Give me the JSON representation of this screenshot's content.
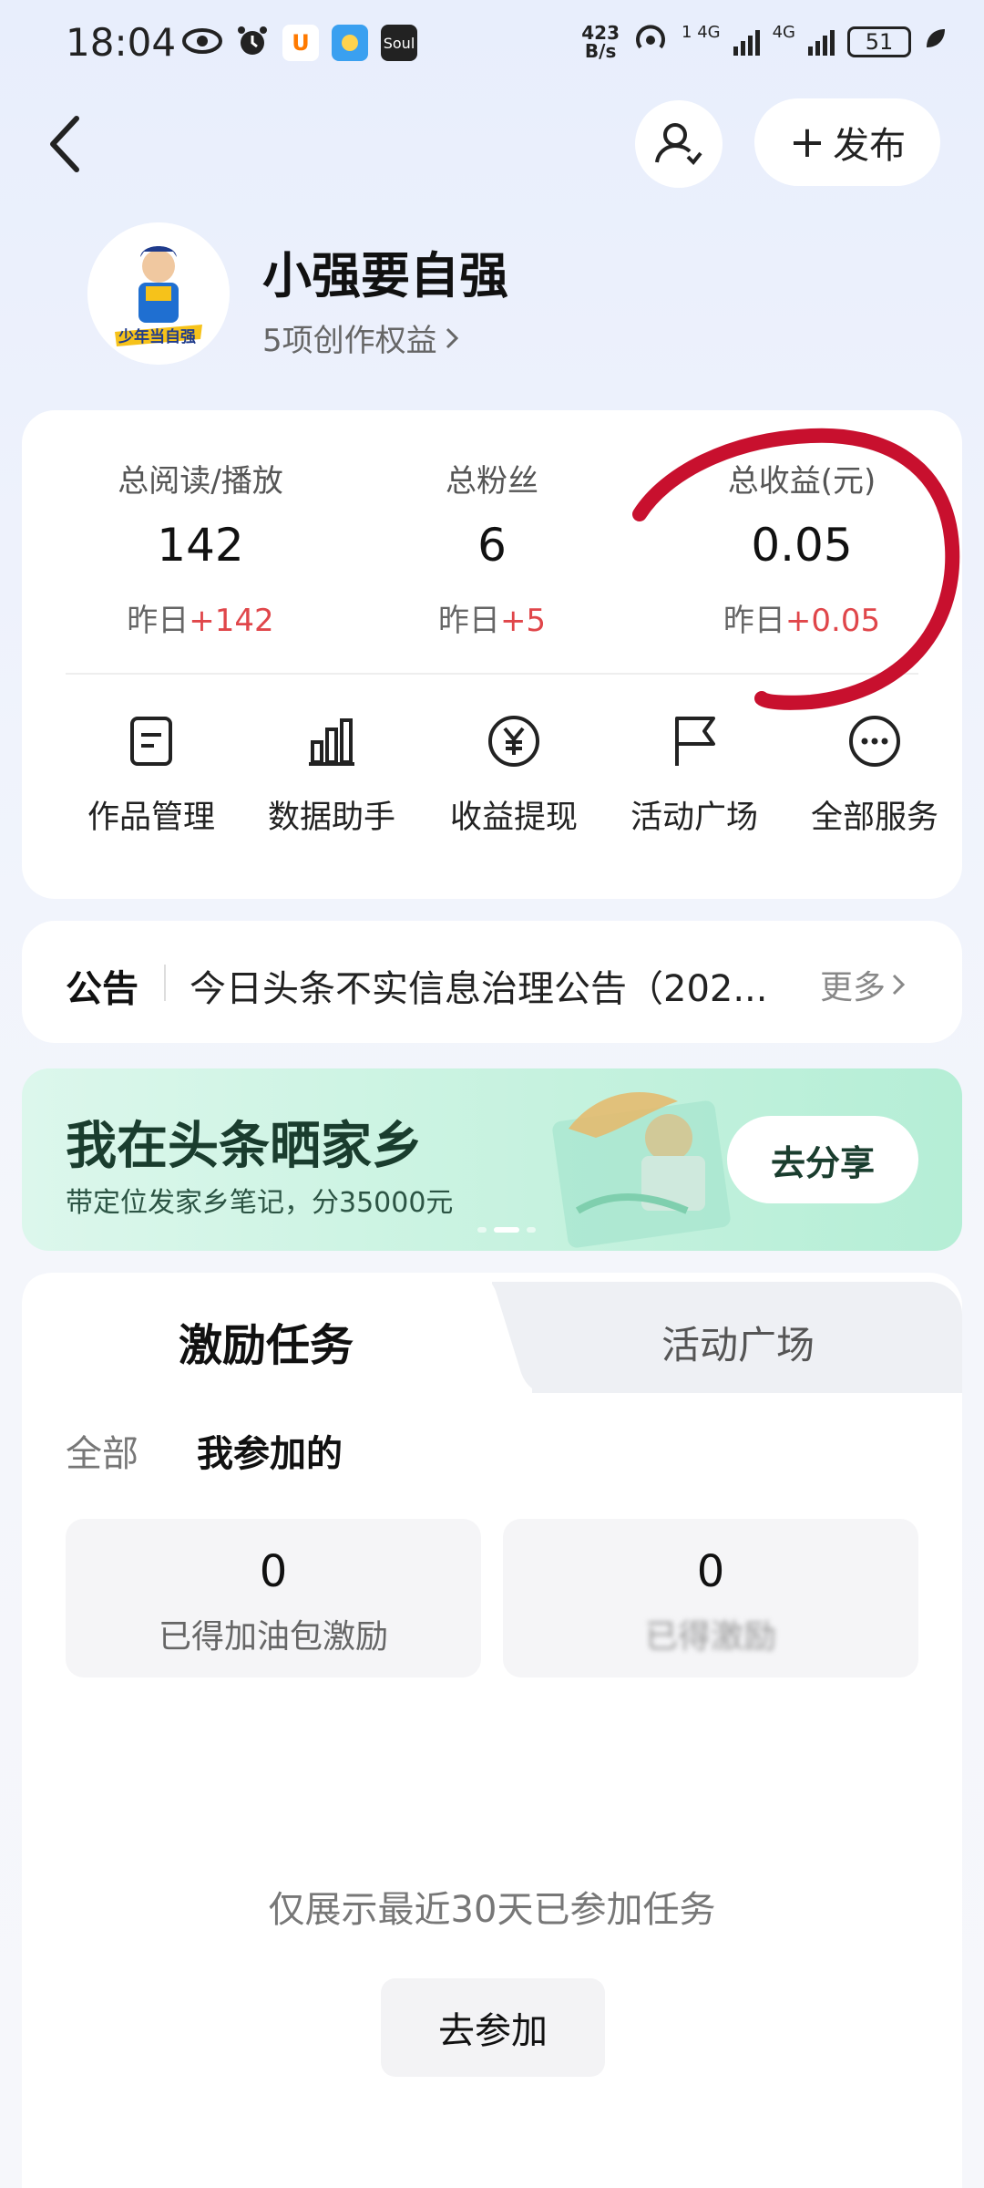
{
  "status_bar": {
    "time": "18:04",
    "net_speed_value": "423",
    "net_speed_unit": "B/s",
    "sim1_label": "4G",
    "sim2_label": "4G",
    "hd_label": "1",
    "battery": "51",
    "soul_label": "Soul"
  },
  "header": {
    "publish_label": "发布"
  },
  "profile": {
    "name": "小强要自强",
    "rights_link": "5项创作权益",
    "avatar_text": "少年当自强"
  },
  "stats": [
    {
      "label": "总阅读/播放",
      "value": "142",
      "delta_prefix": "昨日",
      "delta": "+142"
    },
    {
      "label": "总粉丝",
      "value": "6",
      "delta_prefix": "昨日",
      "delta": "+5"
    },
    {
      "label": "总收益(元)",
      "value": "0.05",
      "delta_prefix": "昨日",
      "delta": "+0.05"
    }
  ],
  "tools": [
    {
      "label": "作品管理",
      "icon": "document-icon"
    },
    {
      "label": "数据助手",
      "icon": "bar-chart-icon"
    },
    {
      "label": "收益提现",
      "icon": "yen-circle-icon"
    },
    {
      "label": "活动广场",
      "icon": "flag-icon"
    },
    {
      "label": "全部服务",
      "icon": "more-dots-icon"
    }
  ],
  "notice": {
    "tag": "公告",
    "text": "今日头条不实信息治理公告（202...",
    "more": "更多"
  },
  "banner": {
    "title": "我在头条晒家乡",
    "subtitle": "带定位发家乡笔记，分35000元",
    "button": "去分享"
  },
  "tasks": {
    "tab_active": "激励任务",
    "tab_inactive": "活动广场",
    "filter_all": "全部",
    "filter_mine": "我参加的",
    "metrics": [
      {
        "value": "0",
        "label": "已得加油包激励"
      },
      {
        "value": "0",
        "label": "已得激励"
      }
    ],
    "empty_hint": "仅展示最近30天已参加任务",
    "join_button": "去参加"
  },
  "colors": {
    "increase": "#e0464a",
    "marker": "#c8102e",
    "banner_text": "#1a3d2e"
  }
}
